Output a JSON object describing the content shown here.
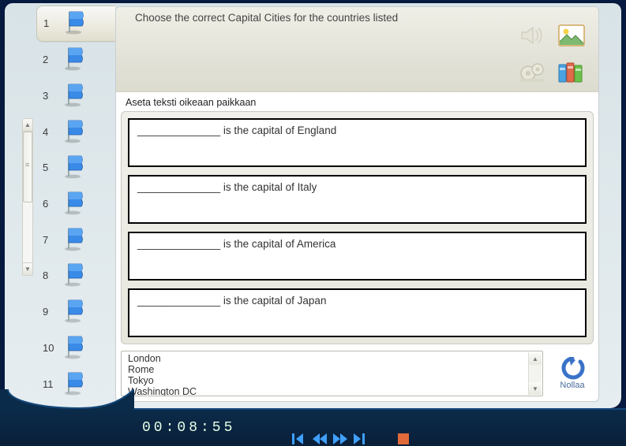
{
  "nav": {
    "items": [
      {
        "num": "1"
      },
      {
        "num": "2"
      },
      {
        "num": "3"
      },
      {
        "num": "4"
      },
      {
        "num": "5"
      },
      {
        "num": "6"
      },
      {
        "num": "7"
      },
      {
        "num": "8"
      },
      {
        "num": "9"
      },
      {
        "num": "10"
      },
      {
        "num": "11"
      }
    ],
    "active_index": 0
  },
  "header": {
    "title": "Choose the correct Capital Cities for the countries listed"
  },
  "instruction": "Aseta teksti oikeaan paikkaan",
  "questions": [
    {
      "text": "______________ is the capital of England"
    },
    {
      "text": "______________ is the capital of Italy"
    },
    {
      "text": "______________ is the capital of America"
    },
    {
      "text": "______________ is the capital of Japan"
    }
  ],
  "options": [
    "London",
    "Rome",
    "Tokyo",
    "Washington DC"
  ],
  "reset_label": "Nollaa",
  "timer": "00:08:55"
}
